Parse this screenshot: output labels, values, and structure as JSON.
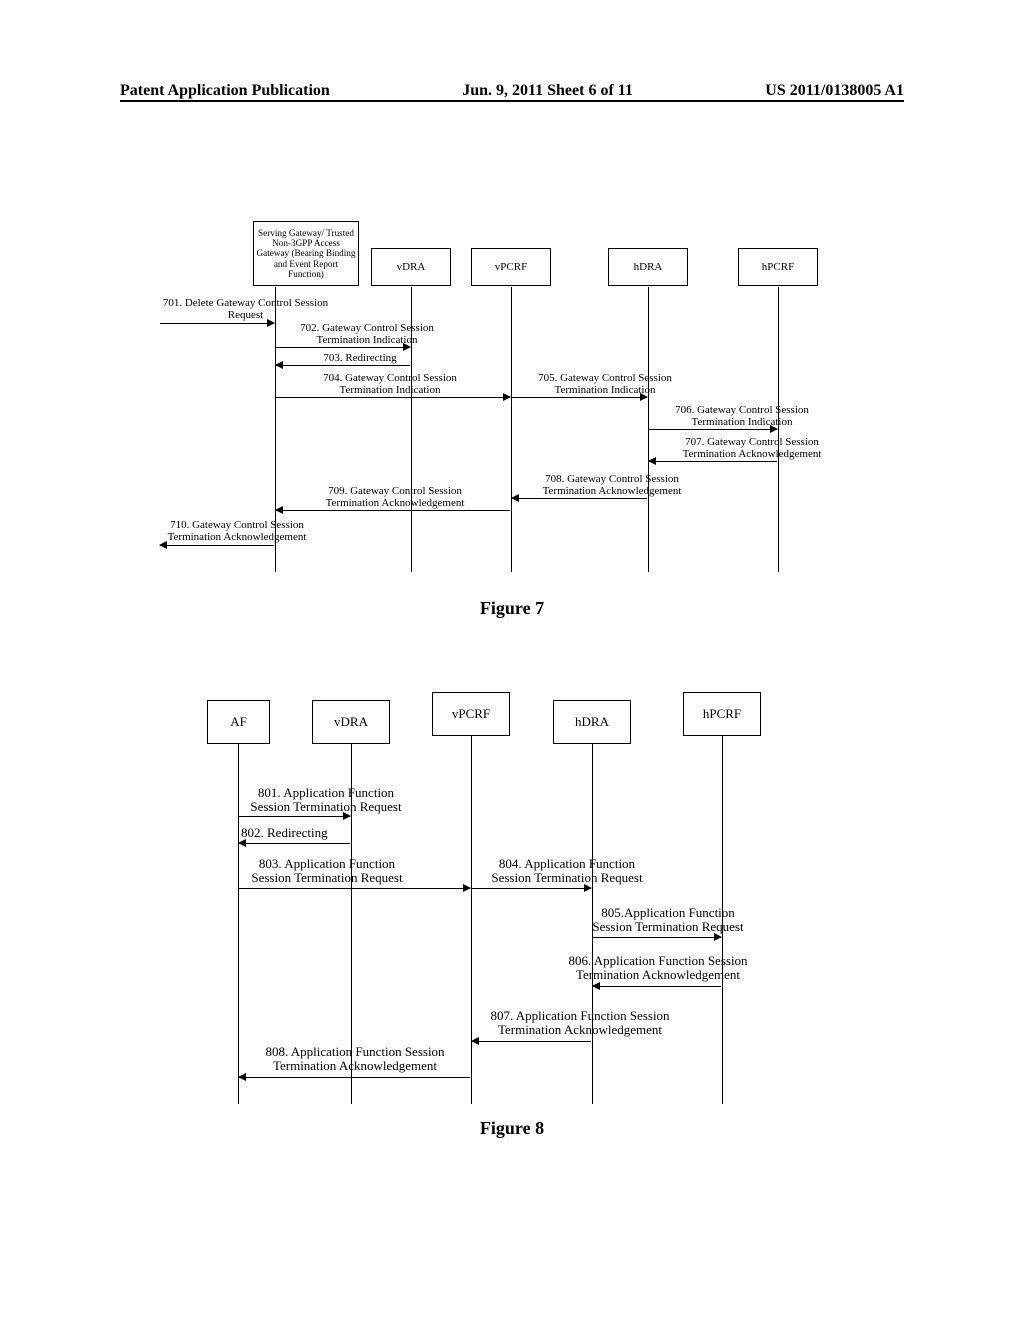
{
  "header": {
    "left": "Patent Application Publication",
    "center": "Jun. 9, 2011  Sheet 6 of 11",
    "right": "US 2011/0138005 A1"
  },
  "fig7": {
    "caption": "Figure 7",
    "actors": {
      "a1": "Serving Gateway/\nTrusted Non-3GPP\nAccess Gateway\n(Bearing Binding\nand Event Report\nFunction)",
      "a2": "vDRA",
      "a3": "vPCRF",
      "a4": "hDRA",
      "a5": "hPCRF"
    },
    "msgs": {
      "m701": "701. Delete Gateway Control Session\nRequest",
      "m702": "702. Gateway Control Session\nTermination Indication",
      "m703": "703. Redirecting",
      "m704": "704. Gateway Control Session\nTermination Indication",
      "m705": "705. Gateway Control Session\nTermination Indication",
      "m706": "706. Gateway Control Session\nTermination Indication",
      "m707": "707. Gateway Control Session\nTermination Acknowledgement",
      "m708": "708. Gateway Control Session\nTermination Acknowledgement",
      "m709": "709. Gateway Control Session\nTermination Acknowledgement",
      "m710": "710. Gateway Control Session\nTermination Acknowledgement"
    }
  },
  "fig8": {
    "caption": "Figure 8",
    "actors": {
      "a1": "AF",
      "a2": "vDRA",
      "a3": "vPCRF",
      "a4": "hDRA",
      "a5": "hPCRF"
    },
    "msgs": {
      "m801": "801. Application Function\nSession Termination Request",
      "m802": "802. Redirecting",
      "m803": "803. Application Function\nSession Termination Request",
      "m804": "804. Application Function\nSession Termination Request",
      "m805": "805.Application Function\nSession Termination Request",
      "m806": "806. Application Function Session\nTermination Acknowledgement",
      "m807": "807. Application Function Session\nTermination Acknowledgement",
      "m808": "808. Application Function Session\nTermination Acknowledgement"
    }
  }
}
